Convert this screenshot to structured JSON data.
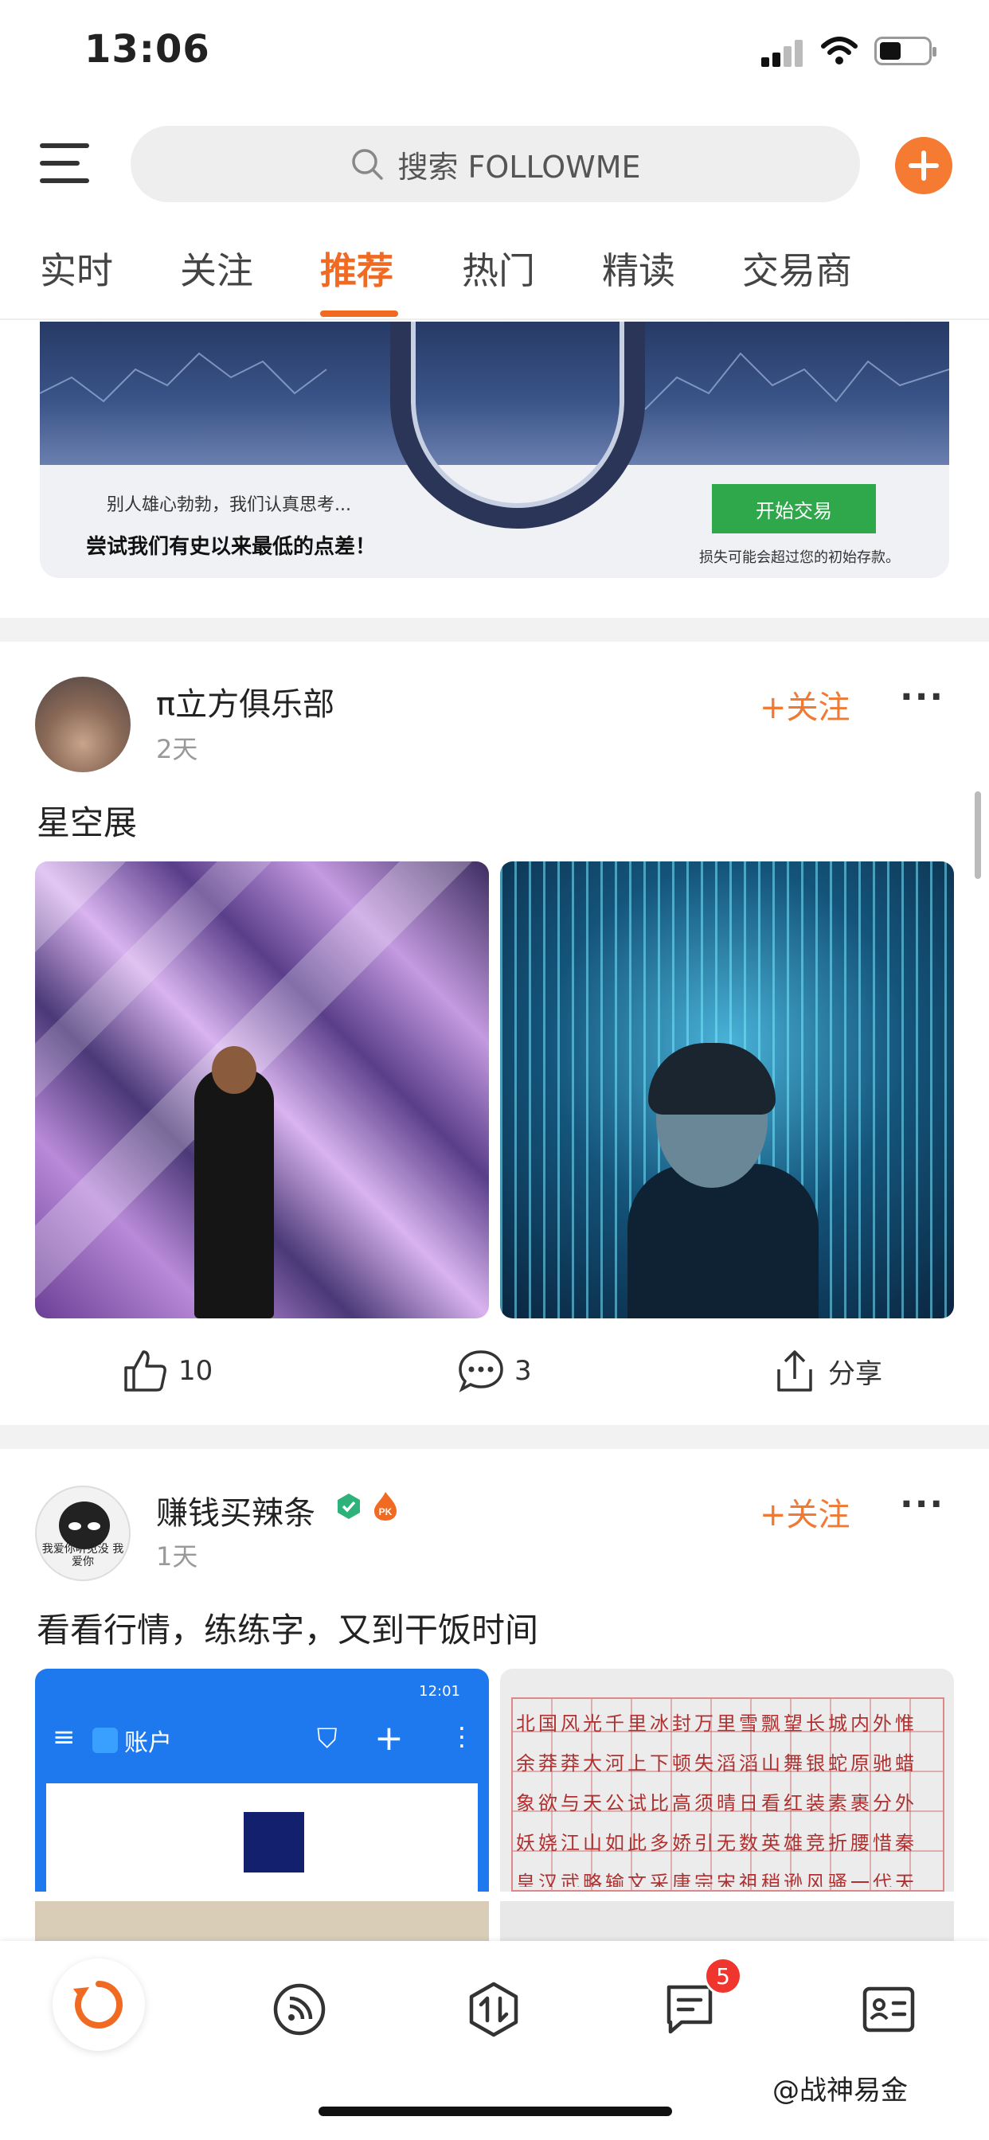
{
  "status_bar": {
    "time": "13:06"
  },
  "search": {
    "placeholder": "搜索 FOLLOWME"
  },
  "tabs": [
    {
      "label": "实时",
      "active": false
    },
    {
      "label": "关注",
      "active": false
    },
    {
      "label": "推荐",
      "active": true
    },
    {
      "label": "热门",
      "active": false
    },
    {
      "label": "精读",
      "active": false
    },
    {
      "label": "交易商",
      "active": false
    }
  ],
  "ad": {
    "line1": "别人雄心勃勃，我们认真思考...",
    "line2": "尝试我们有史以来最低的点差！",
    "button": "开始交易",
    "note": "损失可能会超过您的初始存款。"
  },
  "posts": [
    {
      "user": "π立方俱乐部",
      "time": "2天",
      "follow": "+关注",
      "text": "星空展",
      "likes": "10",
      "comments": "3",
      "share": "分享"
    },
    {
      "user": "赚钱买辣条",
      "time": "1天",
      "follow": "+关注",
      "text": "看看行情，练练字，又到干饭时间",
      "avatar_caption": "我爱你听见没 我爱你",
      "phone_status_time": "12:01",
      "phone_title": "账户",
      "paper_text": "北国风光千里冰封万里雪飘望长城内外惟余莽莽大河上下顿失滔滔山舞银蛇原驰蜡象欲与天公试比高须晴日看红装素裹分外妖娆江山如此多娇引无数英雄竞折腰惜秦皇汉武略输文采唐宗宋祖稍逊风骚一代天骄成吉思汗只识弯弓射大雕俱往矣数风流人物还看今朝"
    }
  ],
  "bottom_nav": {
    "items": [
      "home-refresh-icon",
      "feed-icon",
      "trade-icon",
      "messages-icon",
      "profile-card-icon"
    ],
    "messages_badge": "5"
  },
  "watermark": "@战神易金",
  "colors": {
    "accent": "#f06a22",
    "badge": "#f0342e",
    "ad_button": "#2ea84a"
  }
}
